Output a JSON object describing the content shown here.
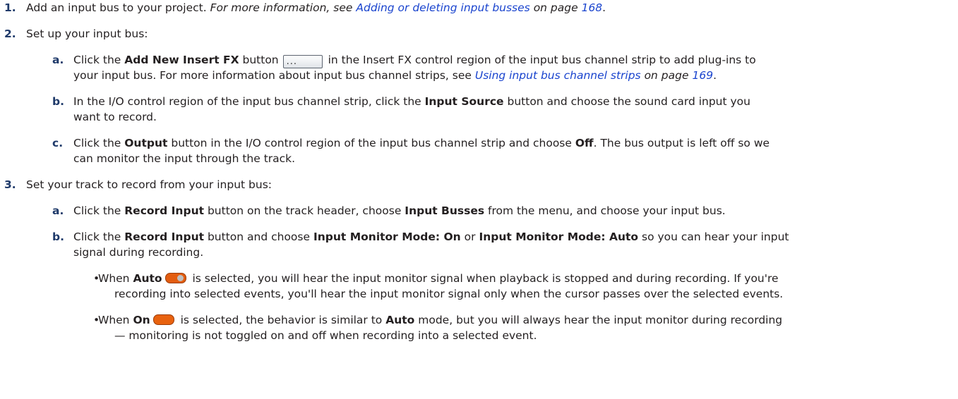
{
  "steps": [
    {
      "number": "1.",
      "text": "Add an input bus to your project.",
      "note_prefix": "For more information, see",
      "link": "Adding or deleting input busses",
      "on_page": "on page",
      "page": "168",
      "end": "."
    },
    {
      "number": "2.",
      "text": "Set up your input bus:",
      "substeps": [
        {
          "letter": "a.",
          "p1": "Click the",
          "b1": "Add New Insert FX",
          "p2": "button",
          "icon_label": "...",
          "p3": "in the Insert FX control region of the input bus channel strip to add plug-ins to",
          "line2": "your input bus. For more information about input bus channel strips, see",
          "link": "Using input bus channel strips",
          "on_page": "on page",
          "page": "169",
          "end": "."
        },
        {
          "letter": "b.",
          "p1": "In the I/O control region of the input bus channel strip, click the",
          "b1": "Input Source",
          "p2": "button and choose the sound card input you",
          "line2": "want to record."
        },
        {
          "letter": "c.",
          "p1": "Click the",
          "b1": "Output",
          "p2": "button in the I/O control region of the input bus channel strip and choose",
          "b2": "Off",
          "p3": ". The bus output is left off so we",
          "line2": "can monitor the input through the track."
        }
      ]
    },
    {
      "number": "3.",
      "text": "Set your track to record from your input bus:",
      "substeps": [
        {
          "letter": "a.",
          "p1": "Click the",
          "b1": "Record Input",
          "p2": "button on the track header, choose",
          "b2": "Input Busses",
          "p3": "from the menu, and choose your input bus."
        },
        {
          "letter": "b.",
          "p1": "Click the",
          "b1": "Record Input",
          "p2": "button and choose",
          "b2": "Input Monitor Mode: On",
          "p3": "or",
          "b3": "Input Monitor Mode: Auto",
          "p4": "so you can hear your input",
          "line2": "signal during recording.",
          "bullets": [
            {
              "mark": "•",
              "p1": "When",
              "b1": "Auto",
              "icon": "auto-toggle-icon",
              "p2": "is selected, you will hear the input monitor signal when playback is stopped and during recording. If you're",
              "line2": "recording into selected events, you'll hear the input monitor signal only when the cursor passes over the selected events."
            },
            {
              "mark": "•",
              "p1": "When",
              "b1": "On",
              "icon": "on-toggle-icon",
              "p2": "is selected, the behavior is similar to",
              "b2": "Auto",
              "p3": "mode, but you will always hear the input monitor during recording",
              "line2": "— monitoring is not toggled on and off when recording into a selected event."
            }
          ]
        }
      ]
    }
  ]
}
